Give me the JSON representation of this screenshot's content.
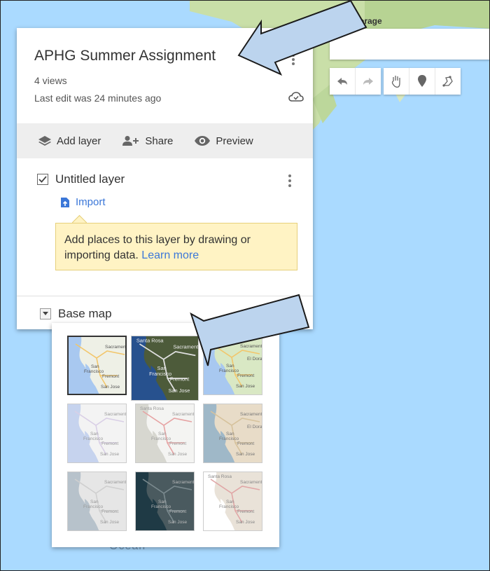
{
  "map": {
    "top_label": "orage",
    "ocean_label": "Ocean"
  },
  "toolbar": {
    "buttons": [
      "undo-icon",
      "redo-icon",
      "hand-icon",
      "marker-icon",
      "draw-line-icon"
    ]
  },
  "panel": {
    "title": "APHG Summer Assignment",
    "views": "4 views",
    "last_edit": "Last edit was 24 minutes ago",
    "actions": {
      "add_layer": "Add layer",
      "share": "Share",
      "preview": "Preview"
    },
    "layer": {
      "name": "Untitled layer",
      "checked": true,
      "import_label": "Import"
    },
    "tip": {
      "text": "Add places to this layer by drawing or importing data.",
      "link": "Learn more"
    },
    "base_map": {
      "label": "Base map"
    }
  },
  "base_map_options": [
    {
      "style": "map",
      "selected": true
    },
    {
      "style": "satellite",
      "selected": false
    },
    {
      "style": "terrain",
      "selected": false
    },
    {
      "style": "light-political",
      "selected": false
    },
    {
      "style": "mono-city",
      "selected": false
    },
    {
      "style": "simple-atlas",
      "selected": false
    },
    {
      "style": "light-landmass",
      "selected": false
    },
    {
      "style": "dark-landmass",
      "selected": false
    },
    {
      "style": "whitewater",
      "selected": false
    }
  ],
  "thumbnail_labels": {
    "sacramento": "Sacramento",
    "san": "San",
    "francisco": "Francisco",
    "fremont": "Fremont",
    "san_jose": "San Jose",
    "santa_rosa": "Santa Rosa",
    "el_dorado": "El Dorado"
  },
  "colors": {
    "link": "#3b77d8",
    "tip_bg": "#fff3c4",
    "ocean": "#aadaff",
    "arrow_fill": "#bcd4ee",
    "arrow_stroke": "#1a1a1a"
  }
}
